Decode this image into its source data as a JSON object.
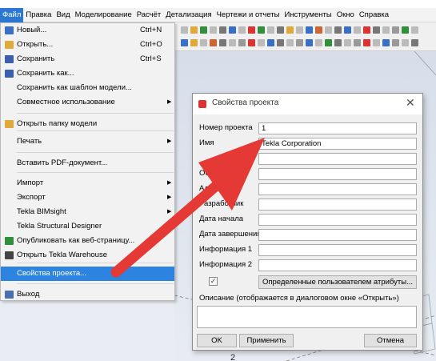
{
  "menubar": {
    "items": [
      {
        "label": "Файл",
        "active": true
      },
      {
        "label": "Правка"
      },
      {
        "label": "Вид"
      },
      {
        "label": "Моделирование"
      },
      {
        "label": "Расчёт"
      },
      {
        "label": "Детализация"
      },
      {
        "label": "Чертежи и отчеты"
      },
      {
        "label": "Инструменты"
      },
      {
        "label": "Окно"
      },
      {
        "label": "Справка"
      }
    ]
  },
  "file_menu": {
    "items": [
      {
        "label": "Новый...",
        "shortcut": "Ctrl+N",
        "icon": "new-file-icon",
        "color": "#3a6fc8"
      },
      {
        "label": "Открыть...",
        "shortcut": "Ctrl+O",
        "icon": "open-folder-icon",
        "color": "#e0a93a"
      },
      {
        "label": "Сохранить",
        "shortcut": "Ctrl+S",
        "icon": "save-icon",
        "color": "#3a5fb0"
      },
      {
        "label": "Сохранить как...",
        "icon": "save-as-icon",
        "color": "#3a5fb0"
      },
      {
        "label": "Сохранить как шаблон модели..."
      },
      {
        "label": "Совместное использование",
        "submenu": true
      },
      {
        "label": "Открыть папку модели",
        "icon": "folder-icon",
        "color": "#e0a93a"
      },
      {
        "label": "Печать",
        "submenu": true
      },
      {
        "label": "Вставить PDF-документ..."
      },
      {
        "label": "Импорт",
        "submenu": true
      },
      {
        "label": "Экспорт",
        "submenu": true
      },
      {
        "label": "Tekla BIMsight",
        "submenu": true
      },
      {
        "label": "Tekla Structural Designer"
      },
      {
        "label": "Опубликовать как веб-страницу...",
        "icon": "globe-icon",
        "color": "#2f8f3a"
      },
      {
        "label": "Открыть Tekla Warehouse",
        "icon": "warehouse-icon",
        "color": "#444444"
      },
      {
        "label": "Свойства проекта...",
        "icon": "properties-icon",
        "color": "#2c84e0",
        "highlighted": true
      },
      {
        "label": "Выход",
        "icon": "exit-icon",
        "color": "#4a6fb0"
      }
    ]
  },
  "dialog": {
    "title": "Свойства проекта",
    "fields": [
      {
        "label": "Номер проекта",
        "value": "1"
      },
      {
        "label": "Имя",
        "value": "Tekla Corporation"
      },
      {
        "label": "",
        "value": ""
      },
      {
        "label": "Объ",
        "value": ""
      },
      {
        "label": "Адрес",
        "value": ""
      },
      {
        "label": "Разработчик",
        "value": ""
      },
      {
        "label": "Дата начала",
        "value": ""
      },
      {
        "label": "Дата завершения",
        "value": ""
      },
      {
        "label": "Информация 1",
        "value": ""
      },
      {
        "label": "Информация 2",
        "value": ""
      }
    ],
    "checkbox_checked": true,
    "user_attributes_label": "Определенные пользователем атрибуты...",
    "description_label": "Описание (отображается в диалоговом окне «Открыть»)",
    "ok_label": "OK",
    "apply_label": "Применить",
    "cancel_label": "Отмена"
  },
  "arrow_color": "#e53935"
}
